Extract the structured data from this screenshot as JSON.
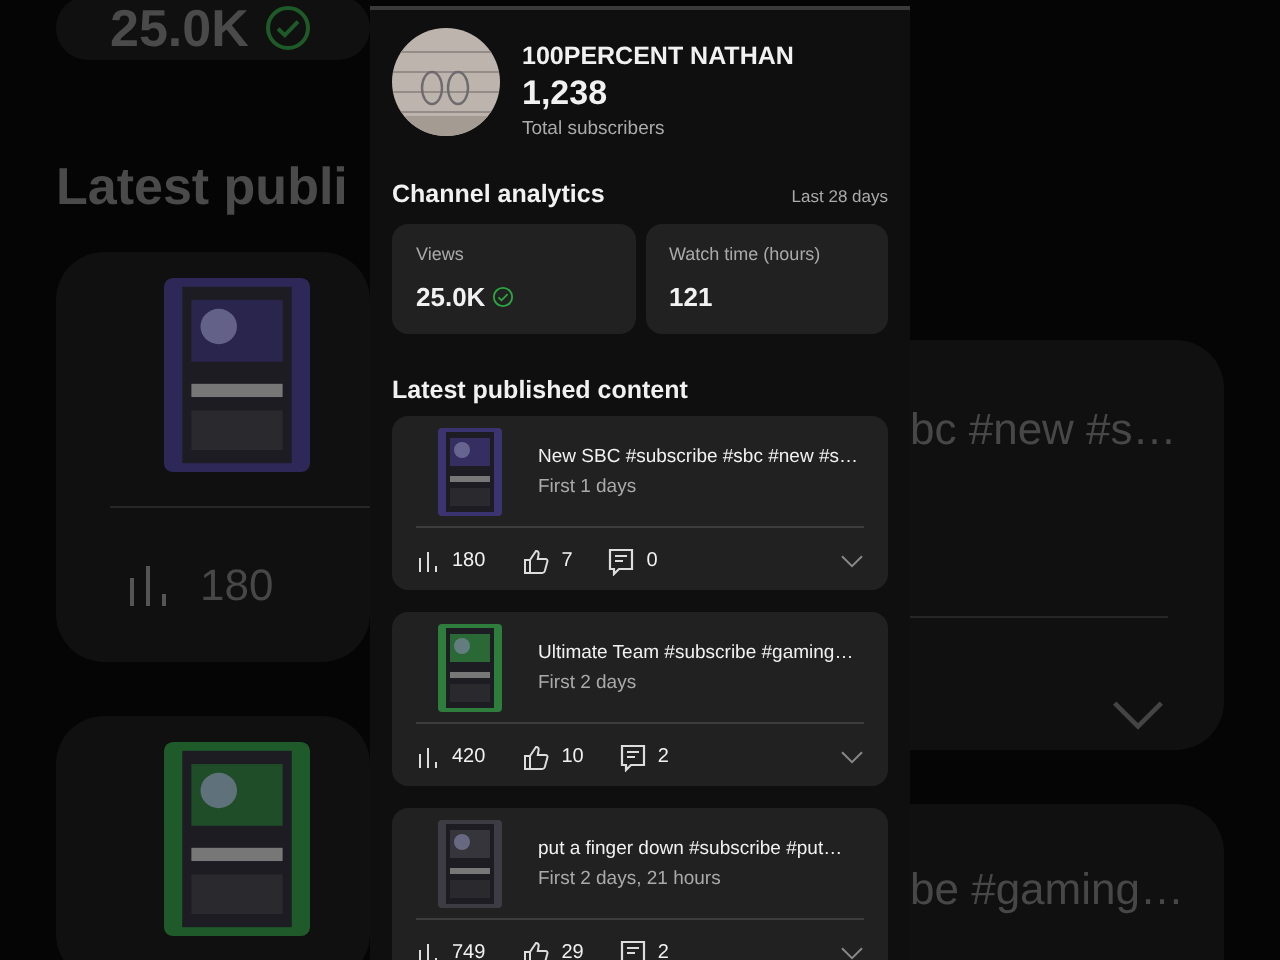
{
  "backdrop": {
    "left": {
      "views_value": "25.0K",
      "verified": true,
      "heading": "Latest publi",
      "views_count": "180"
    },
    "right": {
      "title_1": "bc #new #s…",
      "title_2": "be #gaming…"
    }
  },
  "channel": {
    "name": "100PERCENT NATHAN",
    "subscribers": "1,238",
    "subscribers_label": "Total subscribers"
  },
  "analytics": {
    "title": "Channel analytics",
    "period": "Last 28 days",
    "metrics": [
      {
        "label": "Views",
        "value": "25.0K",
        "verified": true
      },
      {
        "label": "Watch time (hours)",
        "value": "121",
        "verified": false
      }
    ]
  },
  "latest": {
    "title": "Latest published content",
    "videos": [
      {
        "title": "New SBC #subscribe #sbc #new #s…",
        "age": "First 1 days",
        "views": "180",
        "likes": "7",
        "comments": "0",
        "color": "#3b3470"
      },
      {
        "title": "Ultimate Team #subscribe #gaming…",
        "age": "First 2 days",
        "views": "420",
        "likes": "10",
        "comments": "2",
        "color": "#2e7d3c"
      },
      {
        "title": "put a finger down  #subscribe #put…",
        "age": "First 2 days, 21 hours",
        "views": "749",
        "likes": "29",
        "comments": "2",
        "color": "#3c3c42"
      }
    ]
  }
}
